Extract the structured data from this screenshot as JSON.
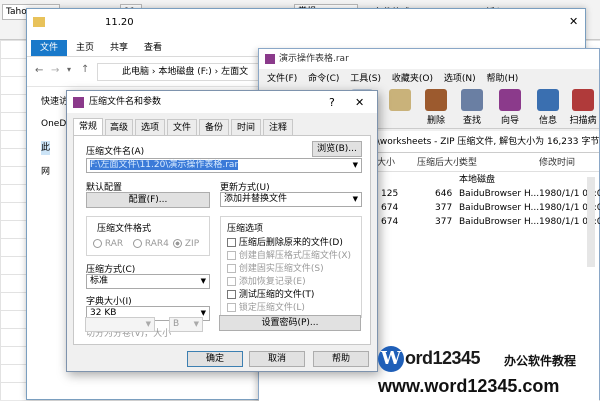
{
  "excel": {
    "font": "Tahoma",
    "size": "11",
    "format": "常规",
    "cond": "条件格式·",
    "insert": "插入"
  },
  "explorer": {
    "title": "11.20",
    "tabs": [
      "文件",
      "主页",
      "共享",
      "查看"
    ],
    "path_parts": [
      "此电脑",
      "本地磁盘 (F:)",
      "左面文"
    ],
    "nav": [
      "快速访问",
      "OneDrive",
      "此",
      "网"
    ]
  },
  "winrar": {
    "title": "演示操作表格.rar",
    "menu": [
      "文件(F)",
      "命令(C)",
      "工具(S)",
      "收藏夹(O)",
      "选项(N)",
      "帮助(H)"
    ],
    "tools": [
      "",
      "",
      "删除",
      "查找",
      "向导",
      "信息",
      "扫描病"
    ],
    "path": "xl\\worksheets - ZIP 压缩文件, 解包大小为 16,233 字节",
    "columns": [
      "大小",
      "压缩后大小",
      "类型",
      "修改时间"
    ],
    "rows": [
      {
        "size": "",
        "packed": "",
        "type": "本地磁盘",
        "date": ""
      },
      {
        "size": "125",
        "packed": "646",
        "type": "BaiduBrowser H...",
        "date": "1980/1/1 00:0"
      },
      {
        "size": "674",
        "packed": "377",
        "type": "BaiduBrowser H...",
        "date": "1980/1/1 00:0"
      },
      {
        "size": "674",
        "packed": "377",
        "type": "BaiduBrowser H...",
        "date": "1980/1/1 00:0"
      }
    ]
  },
  "dialog": {
    "title": "压缩文件名和参数",
    "help": "?",
    "close": "✕",
    "tabs": [
      "常规",
      "高级",
      "选项",
      "文件",
      "备份",
      "时间",
      "注释"
    ],
    "archive_label": "压缩文件名(A)",
    "browse": "浏览(B)...",
    "archive_value": "F:\\左面文件\\11.20\\演示操作表格.rar",
    "default_profile": "默认配置",
    "profile_btn": "配置(F)...",
    "update_label": "更新方式(U)",
    "update_value": "添加并替换文件",
    "format_label": "压缩文件格式",
    "formats": [
      "RAR",
      "RAR4",
      "ZIP"
    ],
    "method_label": "压缩方式(C)",
    "method_value": "标准",
    "dict_label": "字典大小(I)",
    "dict_value": "32 KB",
    "split_label": "切分为分卷(V)，大小",
    "split_unit": "B",
    "options_label": "压缩选项",
    "options": [
      {
        "text": "压缩后删除原来的文件(D)",
        "disabled": false
      },
      {
        "text": "创建自解压格式压缩文件(X)",
        "disabled": true
      },
      {
        "text": "创建固实压缩文件(S)",
        "disabled": true
      },
      {
        "text": "添加恢复记录(E)",
        "disabled": true
      },
      {
        "text": "测试压缩的文件(T)",
        "disabled": false
      },
      {
        "text": "锁定压缩文件(L)",
        "disabled": true
      }
    ],
    "password_btn": "设置密码(P)...",
    "ok": "确定",
    "cancel": "取消",
    "help_btn": "帮助"
  },
  "watermark": {
    "w": "W",
    "brand": "ord12345",
    "cn": "办公软件教程",
    "url": "www.word12345.com"
  }
}
